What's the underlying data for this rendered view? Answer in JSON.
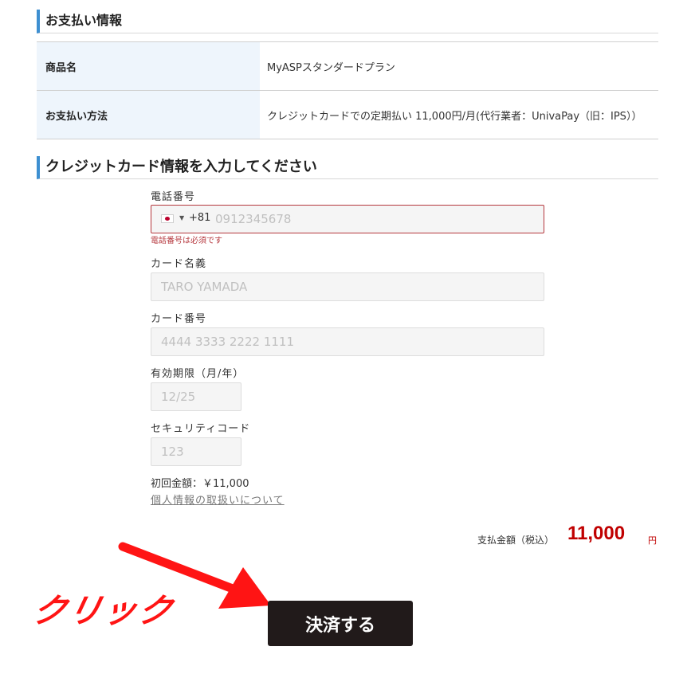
{
  "payment_info": {
    "heading": "お支払い情報",
    "rows": [
      {
        "label": "商品名",
        "value": "MyASPスタンダードプラン"
      },
      {
        "label": "お支払い方法",
        "value": "クレジットカードでの定期払い 11,000円/月(代行業者：UnivaPay（旧：IPS））"
      }
    ]
  },
  "card_form": {
    "heading": "クレジットカード情報を入力してください",
    "phone": {
      "label": "電話番号",
      "country_code": "+81",
      "placeholder": "0912345678",
      "error": "電話番号は必須です"
    },
    "card_name": {
      "label": "カード名義",
      "placeholder": "TARO YAMADA"
    },
    "card_number": {
      "label": "カード番号",
      "placeholder": "4444 3333 2222 1111"
    },
    "expiry": {
      "label": "有効期限（月/年）",
      "placeholder": "12/25"
    },
    "security_code": {
      "label": "セキュリティコード",
      "placeholder": "123"
    },
    "initial_amount": "初回金額：￥11,000",
    "privacy_link": "個人情報の取扱いについて"
  },
  "total": {
    "label": "支払金額（税込）",
    "amount": "11,000",
    "unit": "円"
  },
  "pay_button": {
    "label": "決済する"
  },
  "annotation": {
    "click_text": "クリック",
    "color": "#ff1414"
  },
  "colors": {
    "accent": "#3d8fd1",
    "error": "#b5373d",
    "price": "#c00000",
    "button": "#211a1a"
  },
  "icons": {
    "flag": "japan-flag-icon",
    "caret": "caret-down-icon",
    "arrow": "red-arrow-icon"
  }
}
